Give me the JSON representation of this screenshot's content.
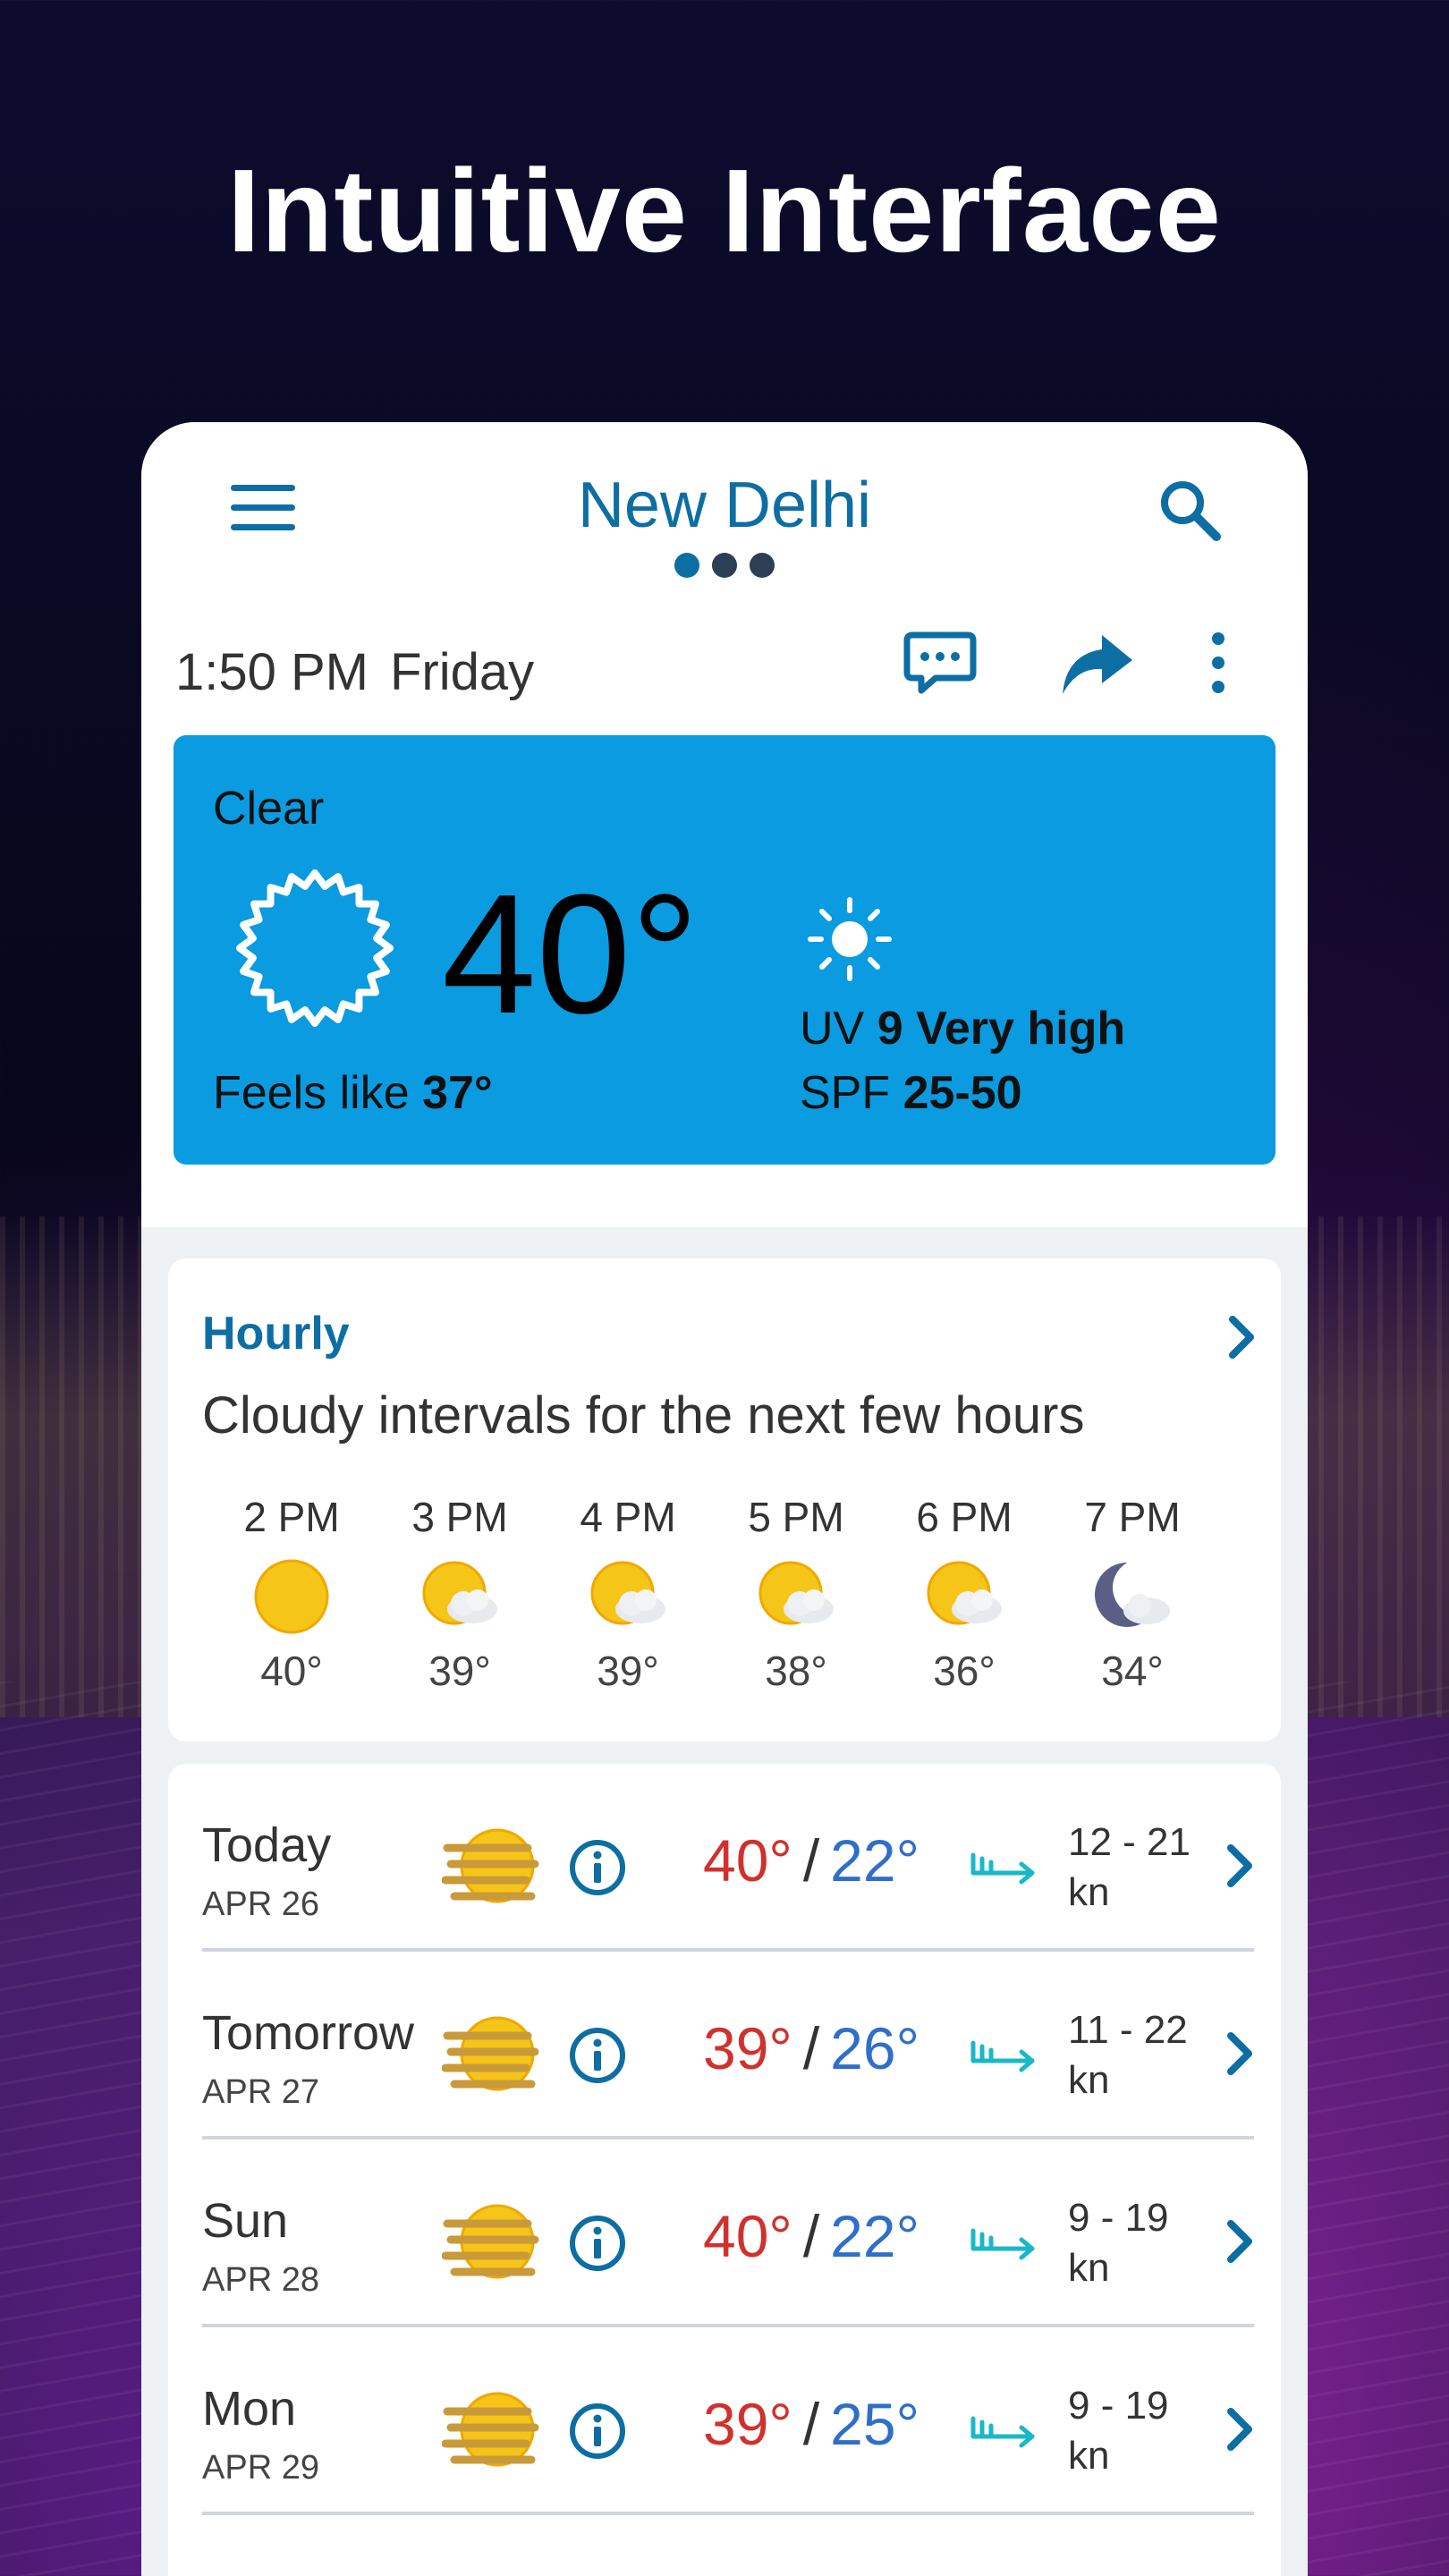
{
  "headline": "Intuitive Interface",
  "header": {
    "city": "New Delhi",
    "time": "1:50 PM",
    "day": "Friday"
  },
  "current": {
    "condition": "Clear",
    "temperature": "40°",
    "feels_like_label": "Feels like",
    "feels_like_value": "37°",
    "uv_label": "UV",
    "uv_value": "9 Very high",
    "spf_label": "SPF",
    "spf_value": "25-50"
  },
  "hourly": {
    "title": "Hourly",
    "description": "Cloudy intervals for the next few hours",
    "hours": [
      {
        "time": "2 PM",
        "temp": "40°",
        "icon": "sun-icon"
      },
      {
        "time": "3 PM",
        "temp": "39°",
        "icon": "partly-cloudy-icon"
      },
      {
        "time": "4 PM",
        "temp": "39°",
        "icon": "partly-cloudy-icon"
      },
      {
        "time": "5 PM",
        "temp": "38°",
        "icon": "partly-cloudy-icon"
      },
      {
        "time": "6 PM",
        "temp": "36°",
        "icon": "partly-cloudy-icon"
      },
      {
        "time": "7 PM",
        "temp": "34°",
        "icon": "night-partly-cloudy-icon"
      }
    ]
  },
  "daily": [
    {
      "name": "Today",
      "date": "APR 26",
      "high": "40°",
      "low": "22°",
      "wind_range": "12 - 21",
      "wind_unit": "kn",
      "icon": "haze-icon"
    },
    {
      "name": "Tomorrow",
      "date": "APR 27",
      "high": "39°",
      "low": "26°",
      "wind_range": "11 - 22",
      "wind_unit": "kn",
      "icon": "haze-icon"
    },
    {
      "name": "Sun",
      "date": "APR 28",
      "high": "40°",
      "low": "22°",
      "wind_range": "9 - 19",
      "wind_unit": "kn",
      "icon": "haze-icon"
    },
    {
      "name": "Mon",
      "date": "APR 29",
      "high": "39°",
      "low": "25°",
      "wind_range": "9 - 19",
      "wind_unit": "kn",
      "icon": "haze-icon"
    }
  ],
  "colors": {
    "accent": "#0d6ea3",
    "current_card": "#0a9be0",
    "high_temp": "#d0312d",
    "low_temp": "#2f6fc9",
    "wind": "#19b8c8"
  }
}
